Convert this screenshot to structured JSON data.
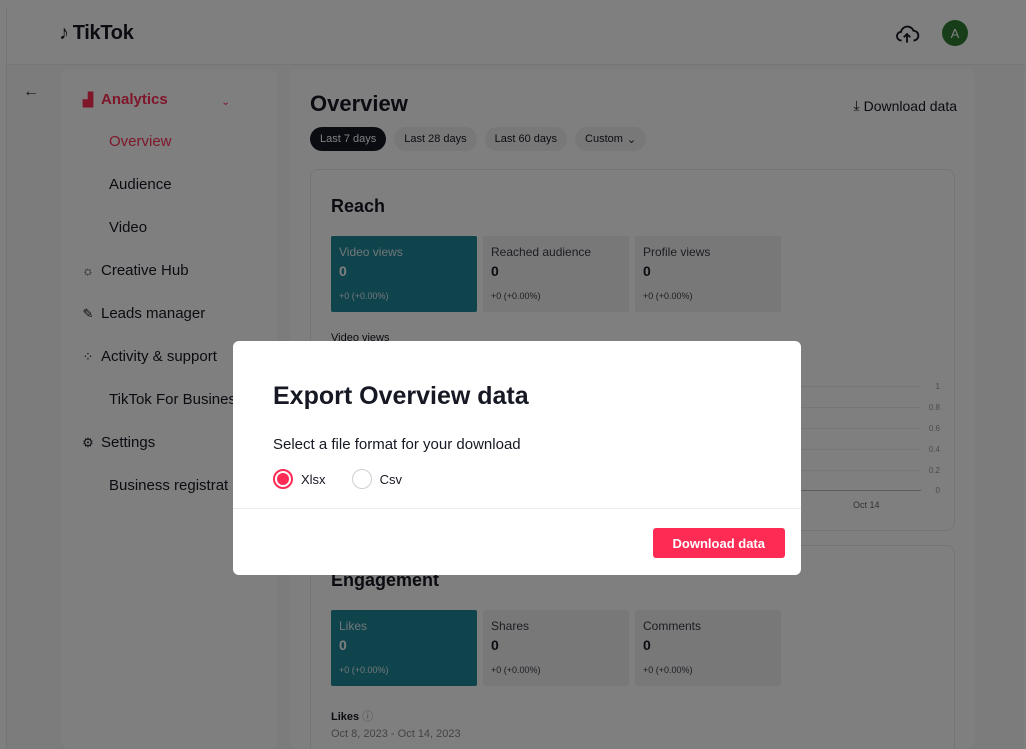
{
  "header": {
    "logo_text": "TikTok",
    "avatar_letter": "A"
  },
  "sidebar": {
    "analytics_label": "Analytics",
    "items": [
      {
        "label": "Overview"
      },
      {
        "label": "Audience"
      },
      {
        "label": "Video"
      },
      {
        "label": "Creative Hub"
      },
      {
        "label": "Leads manager"
      },
      {
        "label": "Activity & support"
      },
      {
        "label": "TikTok For Busines"
      },
      {
        "label": "Settings"
      },
      {
        "label": "Business registrat"
      }
    ]
  },
  "main": {
    "title": "Overview",
    "download_link": "Download data",
    "tabs": [
      {
        "label": "Last 7 days"
      },
      {
        "label": "Last 28 days"
      },
      {
        "label": "Last 60 days"
      },
      {
        "label": "Custom"
      }
    ],
    "reach": {
      "title": "Reach",
      "metrics": [
        {
          "label": "Video views",
          "value": "0",
          "delta": "+0 (+0.00%)"
        },
        {
          "label": "Reached audience",
          "value": "0",
          "delta": "+0 (+0.00%)"
        },
        {
          "label": "Profile views",
          "value": "0",
          "delta": "+0 (+0.00%)"
        }
      ],
      "chart_label": "Video views",
      "y_ticks": [
        "1",
        "0.8",
        "0.6",
        "0.4",
        "0.2",
        "0"
      ],
      "x_tick": "Oct 14"
    },
    "engagement": {
      "title": "Engagement",
      "metrics": [
        {
          "label": "Likes",
          "value": "0",
          "delta": "+0 (+0.00%)"
        },
        {
          "label": "Shares",
          "value": "0",
          "delta": "+0 (+0.00%)"
        },
        {
          "label": "Comments",
          "value": "0",
          "delta": "+0 (+0.00%)"
        }
      ],
      "chart_label": "Likes",
      "date_range": "Oct 8, 2023 - Oct 14, 2023"
    }
  },
  "modal": {
    "title": "Export Overview data",
    "subtitle": "Select a file format for your download",
    "options": [
      {
        "label": "Xlsx",
        "checked": true
      },
      {
        "label": "Csv",
        "checked": false
      }
    ],
    "button": "Download data"
  },
  "colors": {
    "accent": "#fe2c55",
    "metric_active": "#20889a",
    "avatar": "#2e7d32"
  }
}
